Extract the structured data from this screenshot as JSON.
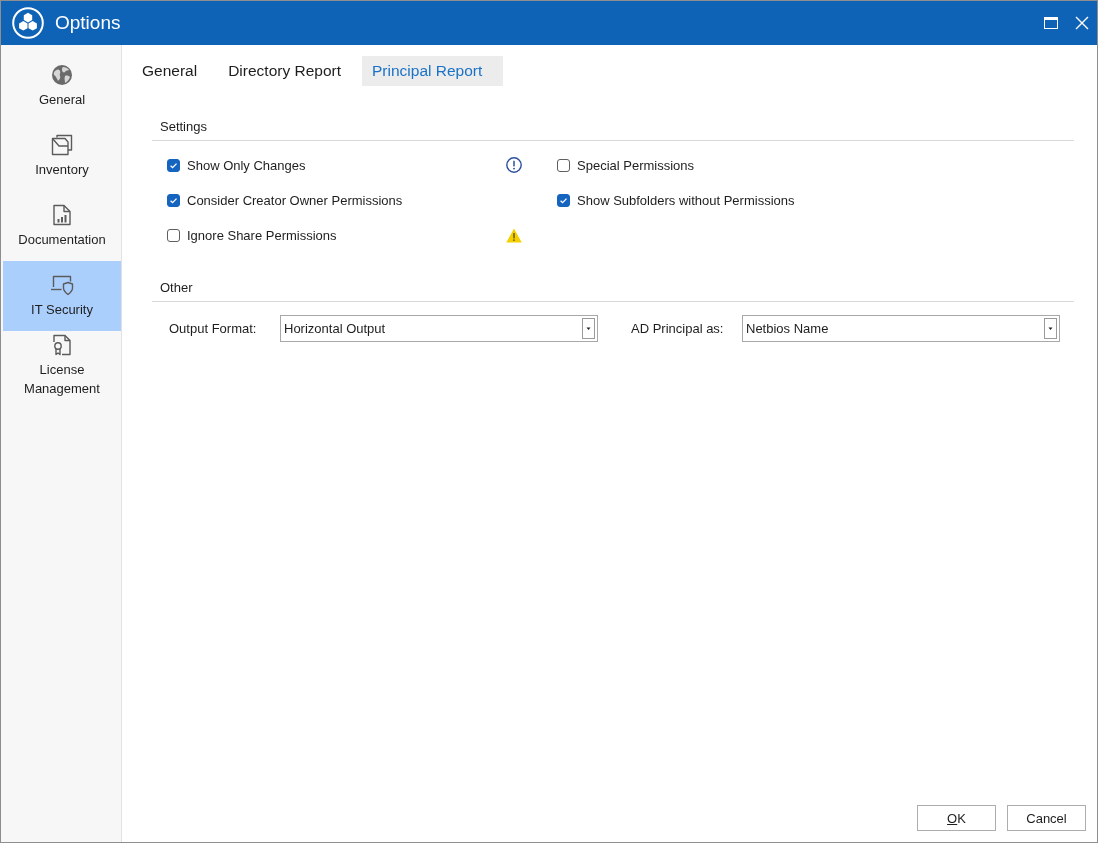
{
  "window": {
    "title": "Options"
  },
  "sidebar": {
    "items": [
      {
        "label": "General",
        "selected": false
      },
      {
        "label": "Inventory",
        "selected": false
      },
      {
        "label": "Documentation",
        "selected": false
      },
      {
        "label": "IT Security",
        "selected": true
      },
      {
        "label": "License Management",
        "selected": false
      }
    ]
  },
  "tabs": [
    {
      "label": "General",
      "selected": false
    },
    {
      "label": "Directory Report",
      "selected": false
    },
    {
      "label": "Principal Report",
      "selected": true
    }
  ],
  "sections": [
    {
      "title": "Settings",
      "kind": "checkboxes",
      "columns": [
        {
          "options": [
            {
              "label": "Show Only Changes",
              "checked": true,
              "kind": "info"
            },
            {
              "label": "Consider Creator Owner Permissions",
              "checked": true,
              "kind": "plain"
            },
            {
              "label": "Ignore Share Permissions",
              "checked": false,
              "kind": "warning"
            }
          ]
        },
        {
          "options": [
            {
              "label": "Special Permissions",
              "checked": false,
              "kind": "plain"
            },
            {
              "label": "Show Subfolders without Permissions",
              "checked": true,
              "kind": "plain"
            }
          ]
        }
      ]
    },
    {
      "title": "Other",
      "kind": "dropdowns",
      "fields": [
        {
          "label": "Output Format:",
          "value": "Horizontal Output"
        },
        {
          "label": "AD Principal as:",
          "value": "Netbios Name"
        }
      ]
    }
  ],
  "buttons": [
    {
      "label": "OK",
      "mnemonic": true
    },
    {
      "label": "Cancel",
      "mnemonic": false
    }
  ]
}
